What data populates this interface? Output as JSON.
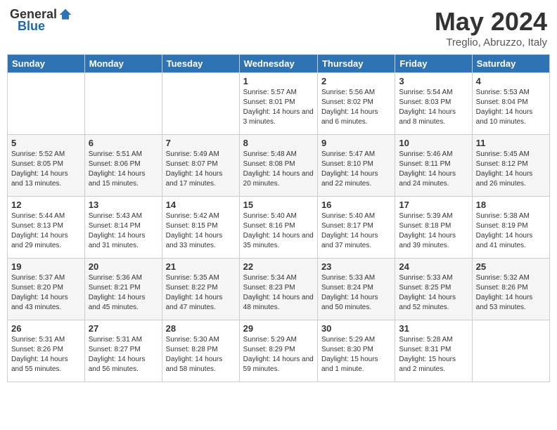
{
  "header": {
    "logo_general": "General",
    "logo_blue": "Blue",
    "month": "May 2024",
    "location": "Treglio, Abruzzo, Italy"
  },
  "weekdays": [
    "Sunday",
    "Monday",
    "Tuesday",
    "Wednesday",
    "Thursday",
    "Friday",
    "Saturday"
  ],
  "weeks": [
    [
      {
        "day": "",
        "sunrise": "",
        "sunset": "",
        "daylight": ""
      },
      {
        "day": "",
        "sunrise": "",
        "sunset": "",
        "daylight": ""
      },
      {
        "day": "",
        "sunrise": "",
        "sunset": "",
        "daylight": ""
      },
      {
        "day": "1",
        "sunrise": "5:57 AM",
        "sunset": "8:01 PM",
        "daylight": "14 hours and 3 minutes."
      },
      {
        "day": "2",
        "sunrise": "5:56 AM",
        "sunset": "8:02 PM",
        "daylight": "14 hours and 6 minutes."
      },
      {
        "day": "3",
        "sunrise": "5:54 AM",
        "sunset": "8:03 PM",
        "daylight": "14 hours and 8 minutes."
      },
      {
        "day": "4",
        "sunrise": "5:53 AM",
        "sunset": "8:04 PM",
        "daylight": "14 hours and 10 minutes."
      }
    ],
    [
      {
        "day": "5",
        "sunrise": "5:52 AM",
        "sunset": "8:05 PM",
        "daylight": "14 hours and 13 minutes."
      },
      {
        "day": "6",
        "sunrise": "5:51 AM",
        "sunset": "8:06 PM",
        "daylight": "14 hours and 15 minutes."
      },
      {
        "day": "7",
        "sunrise": "5:49 AM",
        "sunset": "8:07 PM",
        "daylight": "14 hours and 17 minutes."
      },
      {
        "day": "8",
        "sunrise": "5:48 AM",
        "sunset": "8:08 PM",
        "daylight": "14 hours and 20 minutes."
      },
      {
        "day": "9",
        "sunrise": "5:47 AM",
        "sunset": "8:10 PM",
        "daylight": "14 hours and 22 minutes."
      },
      {
        "day": "10",
        "sunrise": "5:46 AM",
        "sunset": "8:11 PM",
        "daylight": "14 hours and 24 minutes."
      },
      {
        "day": "11",
        "sunrise": "5:45 AM",
        "sunset": "8:12 PM",
        "daylight": "14 hours and 26 minutes."
      }
    ],
    [
      {
        "day": "12",
        "sunrise": "5:44 AM",
        "sunset": "8:13 PM",
        "daylight": "14 hours and 29 minutes."
      },
      {
        "day": "13",
        "sunrise": "5:43 AM",
        "sunset": "8:14 PM",
        "daylight": "14 hours and 31 minutes."
      },
      {
        "day": "14",
        "sunrise": "5:42 AM",
        "sunset": "8:15 PM",
        "daylight": "14 hours and 33 minutes."
      },
      {
        "day": "15",
        "sunrise": "5:40 AM",
        "sunset": "8:16 PM",
        "daylight": "14 hours and 35 minutes."
      },
      {
        "day": "16",
        "sunrise": "5:40 AM",
        "sunset": "8:17 PM",
        "daylight": "14 hours and 37 minutes."
      },
      {
        "day": "17",
        "sunrise": "5:39 AM",
        "sunset": "8:18 PM",
        "daylight": "14 hours and 39 minutes."
      },
      {
        "day": "18",
        "sunrise": "5:38 AM",
        "sunset": "8:19 PM",
        "daylight": "14 hours and 41 minutes."
      }
    ],
    [
      {
        "day": "19",
        "sunrise": "5:37 AM",
        "sunset": "8:20 PM",
        "daylight": "14 hours and 43 minutes."
      },
      {
        "day": "20",
        "sunrise": "5:36 AM",
        "sunset": "8:21 PM",
        "daylight": "14 hours and 45 minutes."
      },
      {
        "day": "21",
        "sunrise": "5:35 AM",
        "sunset": "8:22 PM",
        "daylight": "14 hours and 47 minutes."
      },
      {
        "day": "22",
        "sunrise": "5:34 AM",
        "sunset": "8:23 PM",
        "daylight": "14 hours and 48 minutes."
      },
      {
        "day": "23",
        "sunrise": "5:33 AM",
        "sunset": "8:24 PM",
        "daylight": "14 hours and 50 minutes."
      },
      {
        "day": "24",
        "sunrise": "5:33 AM",
        "sunset": "8:25 PM",
        "daylight": "14 hours and 52 minutes."
      },
      {
        "day": "25",
        "sunrise": "5:32 AM",
        "sunset": "8:26 PM",
        "daylight": "14 hours and 53 minutes."
      }
    ],
    [
      {
        "day": "26",
        "sunrise": "5:31 AM",
        "sunset": "8:26 PM",
        "daylight": "14 hours and 55 minutes."
      },
      {
        "day": "27",
        "sunrise": "5:31 AM",
        "sunset": "8:27 PM",
        "daylight": "14 hours and 56 minutes."
      },
      {
        "day": "28",
        "sunrise": "5:30 AM",
        "sunset": "8:28 PM",
        "daylight": "14 hours and 58 minutes."
      },
      {
        "day": "29",
        "sunrise": "5:29 AM",
        "sunset": "8:29 PM",
        "daylight": "14 hours and 59 minutes."
      },
      {
        "day": "30",
        "sunrise": "5:29 AM",
        "sunset": "8:30 PM",
        "daylight": "15 hours and 1 minute."
      },
      {
        "day": "31",
        "sunrise": "5:28 AM",
        "sunset": "8:31 PM",
        "daylight": "15 hours and 2 minutes."
      },
      {
        "day": "",
        "sunrise": "",
        "sunset": "",
        "daylight": ""
      }
    ]
  ]
}
